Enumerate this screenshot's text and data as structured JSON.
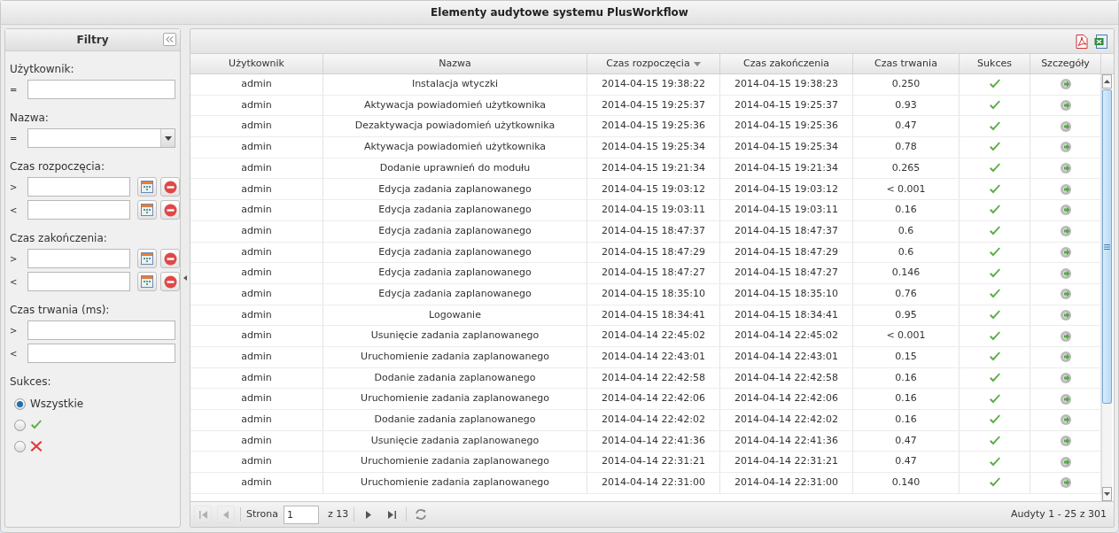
{
  "window": {
    "title": "Elementy audytowe systemu PlusWorkflow"
  },
  "filters": {
    "title": "Filtry",
    "groups": [
      {
        "label": "Użytkownik:",
        "kind": "text",
        "fields": [
          {
            "operator": "="
          }
        ]
      },
      {
        "label": "Nazwa:",
        "kind": "select",
        "fields": [
          {
            "operator": "="
          }
        ]
      },
      {
        "label": "Czas rozpoczęcia:",
        "kind": "date",
        "fields": [
          {
            "operator": ">"
          },
          {
            "operator": "<"
          }
        ]
      },
      {
        "label": "Czas zakończenia:",
        "kind": "date",
        "fields": [
          {
            "operator": ">"
          },
          {
            "operator": "<"
          }
        ]
      },
      {
        "label": "Czas trwania (ms):",
        "kind": "text",
        "fields": [
          {
            "operator": ">"
          },
          {
            "operator": "<"
          }
        ]
      }
    ],
    "success": {
      "label": "Sukces:",
      "options": [
        {
          "kind": "all",
          "label": "Wszystkie",
          "selected": true
        },
        {
          "kind": "success",
          "selected": false
        },
        {
          "kind": "failure",
          "selected": false
        }
      ]
    }
  },
  "table": {
    "columns": [
      {
        "label": "Użytkownik",
        "sorted_descending": false
      },
      {
        "label": "Nazwa",
        "sorted_descending": false
      },
      {
        "label": "Czas rozpoczęcia",
        "sorted_descending": true
      },
      {
        "label": "Czas zakończenia",
        "sorted_descending": false
      },
      {
        "label": "Czas trwania",
        "sorted_descending": false
      },
      {
        "label": "Sukces",
        "sorted_descending": false
      },
      {
        "label": "Szczegóły",
        "sorted_descending": false
      }
    ],
    "rows": [
      {
        "user": "admin",
        "name": "Instalacja wtyczki",
        "start": "2014-04-15 19:38:22",
        "end": "2014-04-15 19:38:23",
        "duration": "0.250",
        "success": true
      },
      {
        "user": "admin",
        "name": "Aktywacja powiadomień użytkownika",
        "start": "2014-04-15 19:25:37",
        "end": "2014-04-15 19:25:37",
        "duration": "0.93",
        "success": true
      },
      {
        "user": "admin",
        "name": "Dezaktywacja powiadomień użytkownika",
        "start": "2014-04-15 19:25:36",
        "end": "2014-04-15 19:25:36",
        "duration": "0.47",
        "success": true
      },
      {
        "user": "admin",
        "name": "Aktywacja powiadomień użytkownika",
        "start": "2014-04-15 19:25:34",
        "end": "2014-04-15 19:25:34",
        "duration": "0.78",
        "success": true
      },
      {
        "user": "admin",
        "name": "Dodanie uprawnień do modułu",
        "start": "2014-04-15 19:21:34",
        "end": "2014-04-15 19:21:34",
        "duration": "0.265",
        "success": true
      },
      {
        "user": "admin",
        "name": "Edycja zadania zaplanowanego",
        "start": "2014-04-15 19:03:12",
        "end": "2014-04-15 19:03:12",
        "duration": "< 0.001",
        "success": true
      },
      {
        "user": "admin",
        "name": "Edycja zadania zaplanowanego",
        "start": "2014-04-15 19:03:11",
        "end": "2014-04-15 19:03:11",
        "duration": "0.16",
        "success": true
      },
      {
        "user": "admin",
        "name": "Edycja zadania zaplanowanego",
        "start": "2014-04-15 18:47:37",
        "end": "2014-04-15 18:47:37",
        "duration": "0.6",
        "success": true
      },
      {
        "user": "admin",
        "name": "Edycja zadania zaplanowanego",
        "start": "2014-04-15 18:47:29",
        "end": "2014-04-15 18:47:29",
        "duration": "0.6",
        "success": true
      },
      {
        "user": "admin",
        "name": "Edycja zadania zaplanowanego",
        "start": "2014-04-15 18:47:27",
        "end": "2014-04-15 18:47:27",
        "duration": "0.146",
        "success": true
      },
      {
        "user": "admin",
        "name": "Edycja zadania zaplanowanego",
        "start": "2014-04-15 18:35:10",
        "end": "2014-04-15 18:35:10",
        "duration": "0.76",
        "success": true
      },
      {
        "user": "admin",
        "name": "Logowanie",
        "start": "2014-04-15 18:34:41",
        "end": "2014-04-15 18:34:41",
        "duration": "0.95",
        "success": true
      },
      {
        "user": "admin",
        "name": "Usunięcie zadania zaplanowanego",
        "start": "2014-04-14 22:45:02",
        "end": "2014-04-14 22:45:02",
        "duration": "< 0.001",
        "success": true
      },
      {
        "user": "admin",
        "name": "Uruchomienie zadania zaplanowanego",
        "start": "2014-04-14 22:43:01",
        "end": "2014-04-14 22:43:01",
        "duration": "0.15",
        "success": true
      },
      {
        "user": "admin",
        "name": "Dodanie zadania zaplanowanego",
        "start": "2014-04-14 22:42:58",
        "end": "2014-04-14 22:42:58",
        "duration": "0.16",
        "success": true
      },
      {
        "user": "admin",
        "name": "Uruchomienie zadania zaplanowanego",
        "start": "2014-04-14 22:42:06",
        "end": "2014-04-14 22:42:06",
        "duration": "0.16",
        "success": true
      },
      {
        "user": "admin",
        "name": "Dodanie zadania zaplanowanego",
        "start": "2014-04-14 22:42:02",
        "end": "2014-04-14 22:42:02",
        "duration": "0.16",
        "success": true
      },
      {
        "user": "admin",
        "name": "Usunięcie zadania zaplanowanego",
        "start": "2014-04-14 22:41:36",
        "end": "2014-04-14 22:41:36",
        "duration": "0.47",
        "success": true
      },
      {
        "user": "admin",
        "name": "Uruchomienie zadania zaplanowanego",
        "start": "2014-04-14 22:31:21",
        "end": "2014-04-14 22:31:21",
        "duration": "0.47",
        "success": true
      },
      {
        "user": "admin",
        "name": "Uruchomienie zadania zaplanowanego",
        "start": "2014-04-14 22:31:00",
        "end": "2014-04-14 22:31:00",
        "duration": "0.140",
        "success": true
      }
    ]
  },
  "paging": {
    "page_label": "Strona",
    "page": "1",
    "of": "z 13",
    "summary": "Audyty 1 - 25 z 301"
  }
}
